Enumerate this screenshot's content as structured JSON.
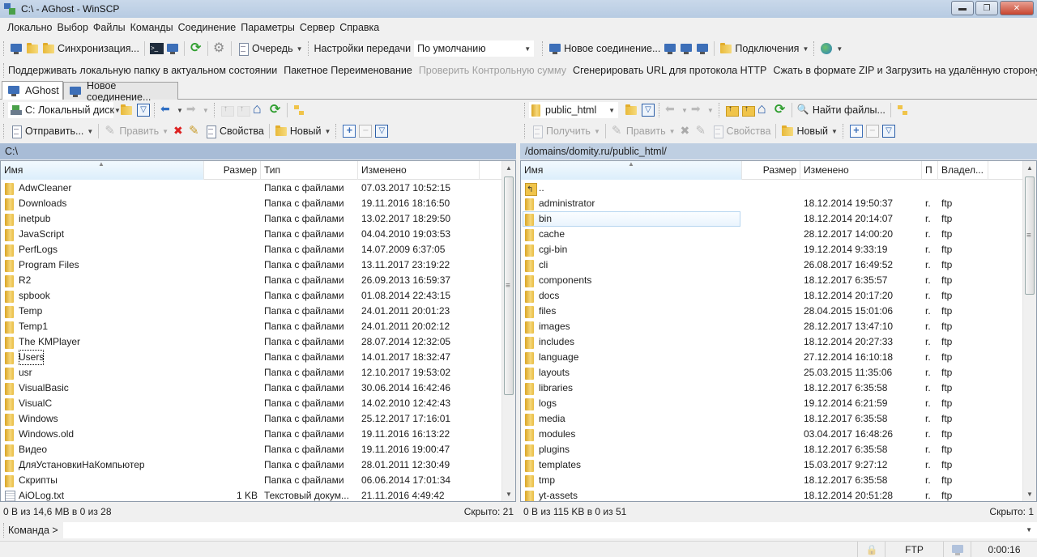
{
  "window": {
    "title": "C:\\ - AGhost - WinSCP",
    "minimize_icon": "minimize-icon",
    "restore_icon": "restore-icon",
    "close_icon": "close-icon"
  },
  "menu": [
    "Локально",
    "Выбор",
    "Файлы",
    "Команды",
    "Соединение",
    "Параметры",
    "Сервер",
    "Справка"
  ],
  "toolbar1": {
    "sync_label": "Синхронизация...",
    "queue_label": "Очередь",
    "transfer_settings_label": "Настройки передачи",
    "transfer_preset": "По умолчанию",
    "new_connection_label": "Новое соединение...",
    "connections_label": "Подключения"
  },
  "toolbar2": {
    "items": [
      {
        "label": "Поддерживать локальную папку в актуальном состоянии",
        "disabled": false
      },
      {
        "label": "Пакетное Переименование",
        "disabled": false
      },
      {
        "label": "Проверить Контрольную сумму",
        "disabled": true
      },
      {
        "label": "Сгенерировать URL для протокола HTTP",
        "disabled": false
      },
      {
        "label": "Сжать в формате ZIP и Загрузить на удалённую сторону",
        "disabled": false
      }
    ],
    "overflow": "»"
  },
  "tabs": [
    {
      "label": "AGhost",
      "active": true
    },
    {
      "label": "Новое соединение...",
      "active": false
    }
  ],
  "local": {
    "drive": "C: Локальный диск",
    "send_label": "Отправить...",
    "edit_label": "Править",
    "properties_label": "Свойства",
    "new_label": "Новый",
    "path": "C:\\",
    "columns": [
      "Имя",
      "Размер",
      "Тип",
      "Изменено"
    ],
    "rows": [
      {
        "name": "AdwCleaner",
        "size": "",
        "type": "Папка с файлами",
        "modified": "07.03.2017  10:52:15",
        "kind": "folder"
      },
      {
        "name": "Downloads",
        "size": "",
        "type": "Папка с файлами",
        "modified": "19.11.2016  18:16:50",
        "kind": "folder"
      },
      {
        "name": "inetpub",
        "size": "",
        "type": "Папка с файлами",
        "modified": "13.02.2017  18:29:50",
        "kind": "folder"
      },
      {
        "name": "JavaScript",
        "size": "",
        "type": "Папка с файлами",
        "modified": "04.04.2010  19:03:53",
        "kind": "folder"
      },
      {
        "name": "PerfLogs",
        "size": "",
        "type": "Папка с файлами",
        "modified": "14.07.2009  6:37:05",
        "kind": "folder"
      },
      {
        "name": "Program Files",
        "size": "",
        "type": "Папка с файлами",
        "modified": "13.11.2017  23:19:22",
        "kind": "folder"
      },
      {
        "name": "R2",
        "size": "",
        "type": "Папка с файлами",
        "modified": "26.09.2013  16:59:37",
        "kind": "folder"
      },
      {
        "name": "spbook",
        "size": "",
        "type": "Папка с файлами",
        "modified": "01.08.2014  22:43:15",
        "kind": "folder"
      },
      {
        "name": "Temp",
        "size": "",
        "type": "Папка с файлами",
        "modified": "24.01.2011  20:01:23",
        "kind": "folder"
      },
      {
        "name": "Temp1",
        "size": "",
        "type": "Папка с файлами",
        "modified": "24.01.2011  20:02:12",
        "kind": "folder"
      },
      {
        "name": "The KMPlayer",
        "size": "",
        "type": "Папка с файлами",
        "modified": "28.07.2014  12:32:05",
        "kind": "folder"
      },
      {
        "name": "Users",
        "size": "",
        "type": "Папка с файлами",
        "modified": "14.01.2017  18:32:47",
        "kind": "folder",
        "focused": true
      },
      {
        "name": "usr",
        "size": "",
        "type": "Папка с файлами",
        "modified": "12.10.2017  19:53:02",
        "kind": "folder"
      },
      {
        "name": "VisualBasic",
        "size": "",
        "type": "Папка с файлами",
        "modified": "30.06.2014  16:42:46",
        "kind": "folder"
      },
      {
        "name": "VisualC",
        "size": "",
        "type": "Папка с файлами",
        "modified": "14.02.2010  12:42:43",
        "kind": "folder"
      },
      {
        "name": "Windows",
        "size": "",
        "type": "Папка с файлами",
        "modified": "25.12.2017  17:16:01",
        "kind": "folder"
      },
      {
        "name": "Windows.old",
        "size": "",
        "type": "Папка с файлами",
        "modified": "19.11.2016  16:13:22",
        "kind": "folder"
      },
      {
        "name": "Видео",
        "size": "",
        "type": "Папка с файлами",
        "modified": "19.11.2016  19:00:47",
        "kind": "folder"
      },
      {
        "name": "ДляУстановкиНаКомпьютер",
        "size": "",
        "type": "Папка с файлами",
        "modified": "28.01.2011  12:30:49",
        "kind": "folder"
      },
      {
        "name": "Скрипты",
        "size": "",
        "type": "Папка с файлами",
        "modified": "06.06.2014  17:01:34",
        "kind": "folder"
      },
      {
        "name": "AiOLog.txt",
        "size": "1 KB",
        "type": "Текстовый докум...",
        "modified": "21.11.2016  4:49:42",
        "kind": "file"
      }
    ],
    "status_left": "0 B из 14,6 MB в 0 из 28",
    "status_right": "Скрыто: 21"
  },
  "remote": {
    "dir": "public_html",
    "find_label": "Найти файлы...",
    "get_label": "Получить",
    "edit_label": "Править",
    "properties_label": "Свойства",
    "new_label": "Новый",
    "path": "/domains/domity.ru/public_html/",
    "columns": [
      "Имя",
      "Размер",
      "Изменено",
      "П",
      "Владел..."
    ],
    "rows": [
      {
        "name": "..",
        "size": "",
        "modified": "",
        "rights": "",
        "owner": "",
        "kind": "up"
      },
      {
        "name": "administrator",
        "size": "",
        "modified": "18.12.2014 19:50:37",
        "rights": "r.",
        "owner": "ftp",
        "kind": "folder"
      },
      {
        "name": "bin",
        "size": "",
        "modified": "18.12.2014 20:14:07",
        "rights": "r.",
        "owner": "ftp",
        "kind": "folder",
        "hover": true
      },
      {
        "name": "cache",
        "size": "",
        "modified": "28.12.2017 14:00:20",
        "rights": "r.",
        "owner": "ftp",
        "kind": "folder"
      },
      {
        "name": "cgi-bin",
        "size": "",
        "modified": "19.12.2014 9:33:19",
        "rights": "r.",
        "owner": "ftp",
        "kind": "folder"
      },
      {
        "name": "cli",
        "size": "",
        "modified": "26.08.2017 16:49:52",
        "rights": "r.",
        "owner": "ftp",
        "kind": "folder"
      },
      {
        "name": "components",
        "size": "",
        "modified": "18.12.2017 6:35:57",
        "rights": "r.",
        "owner": "ftp",
        "kind": "folder"
      },
      {
        "name": "docs",
        "size": "",
        "modified": "18.12.2014 20:17:20",
        "rights": "r.",
        "owner": "ftp",
        "kind": "folder"
      },
      {
        "name": "files",
        "size": "",
        "modified": "28.04.2015 15:01:06",
        "rights": "r.",
        "owner": "ftp",
        "kind": "folder"
      },
      {
        "name": "images",
        "size": "",
        "modified": "28.12.2017 13:47:10",
        "rights": "r.",
        "owner": "ftp",
        "kind": "folder"
      },
      {
        "name": "includes",
        "size": "",
        "modified": "18.12.2014 20:27:33",
        "rights": "r.",
        "owner": "ftp",
        "kind": "folder"
      },
      {
        "name": "language",
        "size": "",
        "modified": "27.12.2014 16:10:18",
        "rights": "r.",
        "owner": "ftp",
        "kind": "folder"
      },
      {
        "name": "layouts",
        "size": "",
        "modified": "25.03.2015 11:35:06",
        "rights": "r.",
        "owner": "ftp",
        "kind": "folder"
      },
      {
        "name": "libraries",
        "size": "",
        "modified": "18.12.2017 6:35:58",
        "rights": "r.",
        "owner": "ftp",
        "kind": "folder"
      },
      {
        "name": "logs",
        "size": "",
        "modified": "19.12.2014 6:21:59",
        "rights": "r.",
        "owner": "ftp",
        "kind": "folder"
      },
      {
        "name": "media",
        "size": "",
        "modified": "18.12.2017 6:35:58",
        "rights": "r.",
        "owner": "ftp",
        "kind": "folder"
      },
      {
        "name": "modules",
        "size": "",
        "modified": "03.04.2017 16:48:26",
        "rights": "r.",
        "owner": "ftp",
        "kind": "folder"
      },
      {
        "name": "plugins",
        "size": "",
        "modified": "18.12.2017 6:35:58",
        "rights": "r.",
        "owner": "ftp",
        "kind": "folder"
      },
      {
        "name": "templates",
        "size": "",
        "modified": "15.03.2017 9:27:12",
        "rights": "r.",
        "owner": "ftp",
        "kind": "folder"
      },
      {
        "name": "tmp",
        "size": "",
        "modified": "18.12.2017 6:35:58",
        "rights": "r.",
        "owner": "ftp",
        "kind": "folder"
      },
      {
        "name": "yt-assets",
        "size": "",
        "modified": "18.12.2014 20:51:28",
        "rights": "r.",
        "owner": "ftp",
        "kind": "folder"
      }
    ],
    "status_left": "0 B из 115 KB в 0 из 51",
    "status_right": "Скрыто: 1"
  },
  "command": {
    "label": "Команда >",
    "value": ""
  },
  "statusbar": {
    "protocol": "FTP",
    "elapsed": "0:00:16"
  }
}
